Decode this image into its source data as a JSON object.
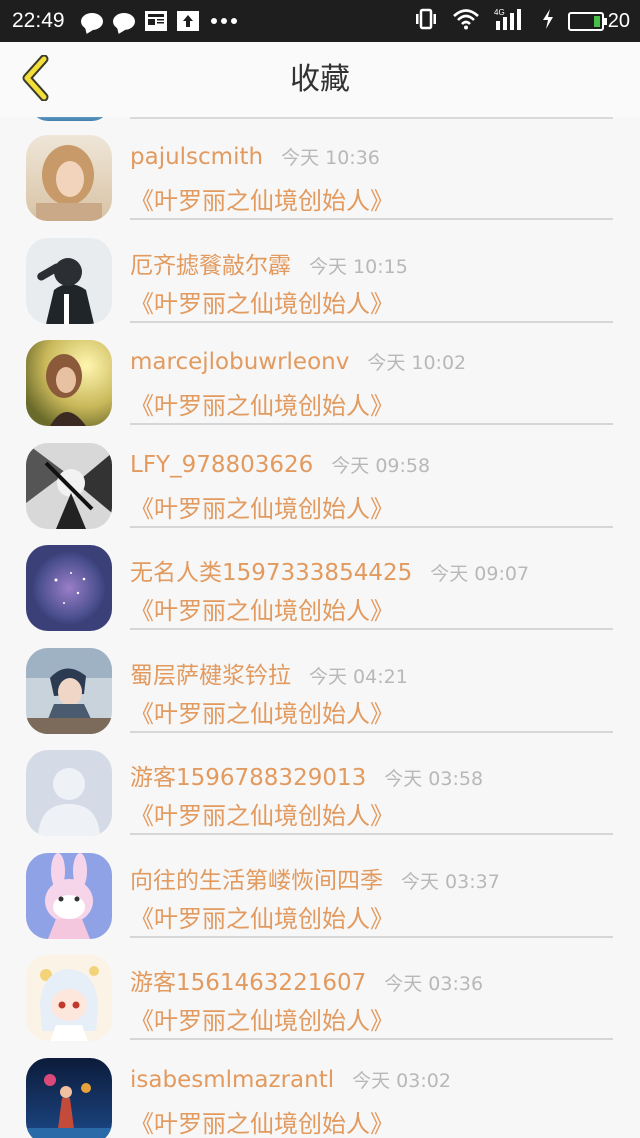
{
  "status_bar": {
    "time": "22:49",
    "network": "4G",
    "battery": "20",
    "icons": [
      "chat-bubble-icon",
      "chat-bubble-icon",
      "news-icon",
      "upload-icon",
      "more-dots-icon",
      "vibrate-icon",
      "wifi-icon",
      "signal-icon",
      "charging-icon",
      "battery-icon"
    ]
  },
  "header": {
    "title": "收藏",
    "back_icon": "chevron-left-icon"
  },
  "items": [
    {
      "name": "pajulscmith",
      "time": "今天 10:36",
      "title": "《叶罗丽之仙境创始人》",
      "avatar": "avatar-girl-portrait"
    },
    {
      "name": "厄齐摅餮敲尔霹",
      "time": "今天 10:15",
      "title": "《叶罗丽之仙境创始人》",
      "avatar": "avatar-hooded-figure"
    },
    {
      "name": "marcejlobuwrleonv",
      "time": "今天 10:02",
      "title": "《叶罗丽之仙境创始人》",
      "avatar": "avatar-woman-sunlight"
    },
    {
      "name": "LFY_978803626",
      "time": "今天 09:58",
      "title": "《叶罗丽之仙境创始人》",
      "avatar": "avatar-bw-anime"
    },
    {
      "name": "无名人类1597333854425",
      "time": "今天 09:07",
      "title": "《叶罗丽之仙境创始人》",
      "avatar": "avatar-galaxy"
    },
    {
      "name": "蜀层萨楗浆钤拉",
      "time": "今天 04:21",
      "title": "《叶罗丽之仙境创始人》",
      "avatar": "avatar-anime-boy"
    },
    {
      "name": "游客1596788329013",
      "time": "今天 03:58",
      "title": "《叶罗丽之仙境创始人》",
      "avatar": "avatar-default-silhouette"
    },
    {
      "name": "向往的生活第嵝恢间四季",
      "time": "今天 03:37",
      "title": "《叶罗丽之仙境创始人》",
      "avatar": "avatar-bunny-cartoon"
    },
    {
      "name": "游客1561463221607",
      "time": "今天 03:36",
      "title": "《叶罗丽之仙境创始人》",
      "avatar": "avatar-anime-girl-white-hair"
    },
    {
      "name": "isabesmlmazrantl",
      "time": "今天 03:02",
      "title": "《叶罗丽之仙境创始人》",
      "avatar": "avatar-neon-city"
    }
  ],
  "colors": {
    "accent": "#e29a5f",
    "time_text": "#b8b8b8",
    "background": "#f7f7f7",
    "status_bar": "#1e1e1e"
  }
}
